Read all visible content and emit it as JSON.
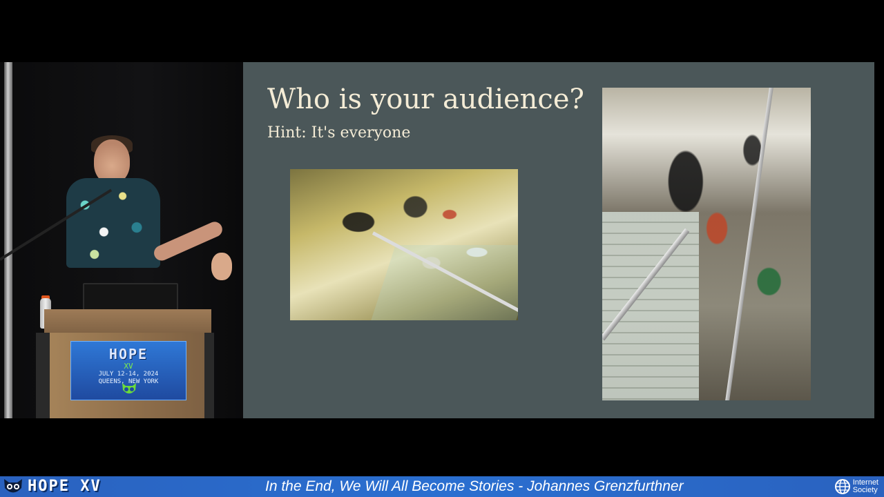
{
  "slide": {
    "title": "Who is your audience?",
    "subtitle": "Hint: It's everyone"
  },
  "podium_sign": {
    "title": "HOPE",
    "edition": "XV",
    "dates": "JULY 12-14, 2024",
    "location": "QUEENS, NEW YORK"
  },
  "banner": {
    "logo_text": "HOPE XV",
    "talk_title": "In the End, We Will All Become Stories - Johannes Grenzfurthner",
    "sponsor_line1": "Internet",
    "sponsor_line2": "Society"
  },
  "icons": {
    "banner_logo": "owl-icon",
    "sponsor": "globe-icon"
  },
  "colors": {
    "slide_background": "#4b5759",
    "slide_text": "#f4ecd6",
    "banner_background": "#2a6fd0",
    "banner_text": "#ffffff"
  }
}
